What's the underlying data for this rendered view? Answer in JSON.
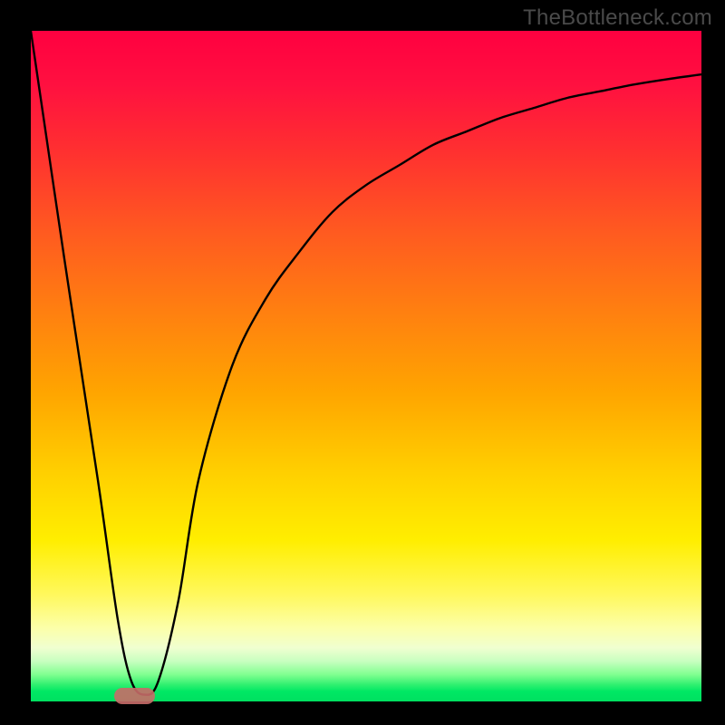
{
  "watermark": "TheBottleneck.com",
  "chart_data": {
    "type": "line",
    "title": "",
    "xlabel": "",
    "ylabel": "",
    "xlim": [
      0,
      100
    ],
    "ylim": [
      0,
      100
    ],
    "background": "vertical-gradient red→orange→yellow→green",
    "series": [
      {
        "name": "bottleneck-curve",
        "x": [
          0,
          5,
          10,
          13,
          15,
          17,
          19,
          22,
          25,
          30,
          35,
          40,
          45,
          50,
          55,
          60,
          65,
          70,
          75,
          80,
          85,
          90,
          95,
          100
        ],
        "values": [
          100,
          66,
          33,
          12,
          3,
          1,
          3,
          15,
          33,
          50,
          60,
          67,
          73,
          77,
          80,
          83,
          85,
          87,
          88.5,
          90,
          91,
          92,
          92.8,
          93.5
        ]
      }
    ],
    "marker": {
      "name": "optimal-range",
      "x_start": 13,
      "x_end": 18,
      "y": 0.8
    },
    "colors": {
      "curve": "#000000",
      "marker": "#c86b68",
      "frame": "#000000"
    }
  }
}
